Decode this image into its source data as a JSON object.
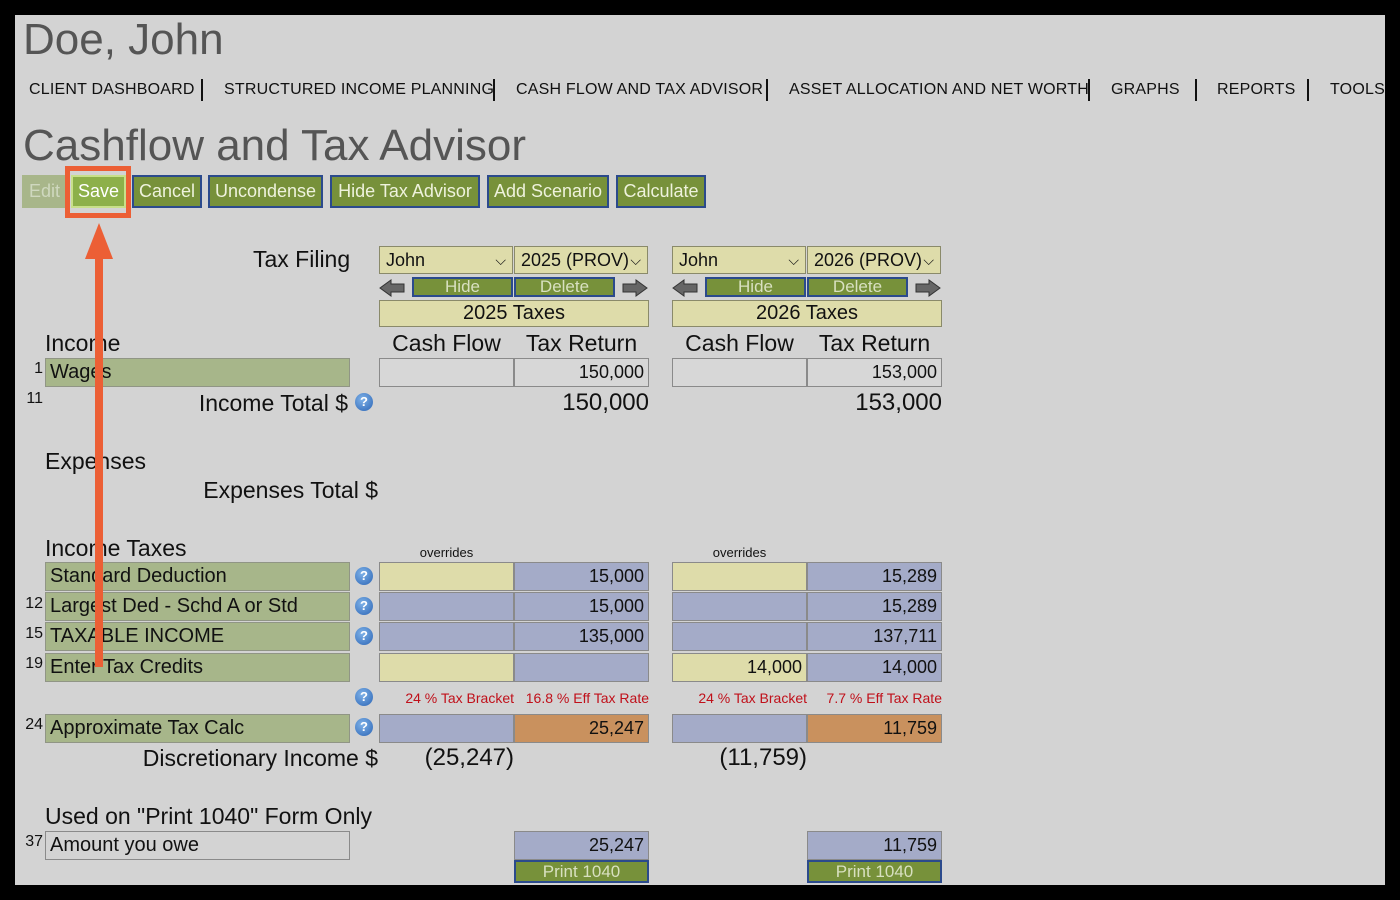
{
  "client_name": "Doe, John",
  "nav": [
    "CLIENT DASHBOARD",
    "STRUCTURED INCOME PLANNING",
    "CASH FLOW AND TAX ADVISOR",
    "ASSET ALLOCATION AND NET WORTH",
    "GRAPHS",
    "REPORTS",
    "TOOLS"
  ],
  "page_title": "Cashflow and Tax Advisor",
  "toolbar": {
    "edit": "Edit",
    "save": "Save",
    "cancel": "Cancel",
    "uncondense": "Uncondense",
    "hide_tax_advisor": "Hide Tax Advisor",
    "add_scenario": "Add Scenario",
    "calculate": "Calculate"
  },
  "tax_filing_label": "Tax Filing",
  "scenarios": [
    {
      "person": "John",
      "year": "2025 (PROV)",
      "hide": "Hide",
      "delete": "Delete",
      "taxes_header": "2025 Taxes",
      "cash_flow": "Cash Flow",
      "tax_return": "Tax Return",
      "wages": "150,000",
      "income_total": "150,000",
      "overrides": "overrides",
      "std_ded": "15,000",
      "largest_ded": "15,000",
      "taxable_income": "135,000",
      "tax_credits_cf": "",
      "tax_credits": "",
      "bracket": "24 % Tax Bracket",
      "eff_rate": "16.8 % Eff Tax Rate",
      "approx_tax": "25,247",
      "discretionary": "(25,247)",
      "amount_owe": "25,247",
      "print": "Print 1040"
    },
    {
      "person": "John",
      "year": "2026 (PROV)",
      "hide": "Hide",
      "delete": "Delete",
      "taxes_header": "2026 Taxes",
      "cash_flow": "Cash Flow",
      "tax_return": "Tax Return",
      "wages": "153,000",
      "income_total": "153,000",
      "overrides": "overrides",
      "std_ded": "15,289",
      "largest_ded": "15,289",
      "taxable_income": "137,711",
      "tax_credits_cf": "14,000",
      "tax_credits": "14,000",
      "bracket": "24 % Tax Bracket",
      "eff_rate": "7.7 % Eff Tax Rate",
      "approx_tax": "11,759",
      "discretionary": "(11,759)",
      "amount_owe": "11,759",
      "print": "Print 1040"
    }
  ],
  "sections": {
    "income": "Income",
    "expenses": "Expenses",
    "income_taxes": "Income Taxes",
    "print_form": "Used on \"Print 1040\" Form Only"
  },
  "rows": {
    "wages": {
      "num": "1",
      "label": "Wages"
    },
    "income_total": {
      "num": "11",
      "label": "Income Total $"
    },
    "expenses_total": {
      "label": "Expenses Total $"
    },
    "std_ded": {
      "num": "",
      "label": "Standard Deduction"
    },
    "largest_ded": {
      "num": "12",
      "label": "Largest Ded - Schd A or Std"
    },
    "taxable": {
      "num": "15",
      "label": "TAXABLE INCOME"
    },
    "credits": {
      "num": "19",
      "label": "Enter Tax Credits"
    },
    "approx": {
      "num": "24",
      "label": "Approximate Tax Calc"
    },
    "discretionary": {
      "label": "Discretionary Income $"
    },
    "amount_owe": {
      "num": "37",
      "label": "Amount you owe"
    }
  },
  "help_glyph": "?",
  "highlight_color": "#ec5f35"
}
